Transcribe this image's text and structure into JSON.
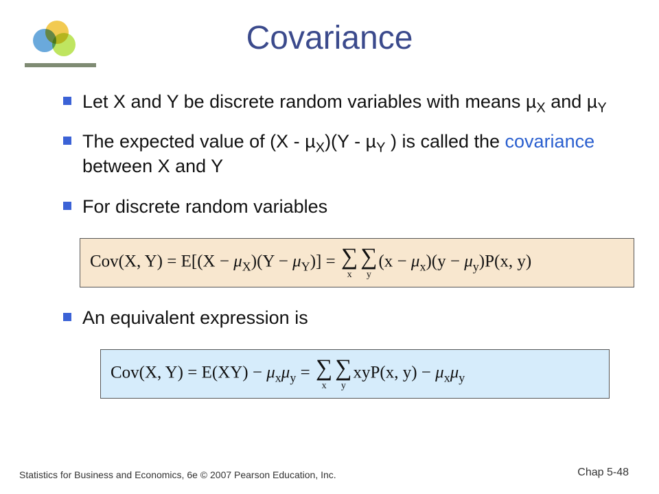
{
  "title": "Covariance",
  "bullets": {
    "b1_prefix": "Let  X  and  Y  be discrete random variables with means µ",
    "b1_x": "X",
    "b1_mid": "  and  µ",
    "b1_y": "Y",
    "b2_prefix": "The expected value of  (X - µ",
    "b2_x": "X",
    "b2_mid1": ")(Y - µ",
    "b2_y": "Y",
    "b2_mid2": " )  is called the ",
    "b2_covar": "covariance",
    "b2_suffix": " between  X  and  Y",
    "b3": "For discrete random variables",
    "b4": "An equivalent expression is"
  },
  "formula1": {
    "lhs": "Cov(X, Y) = E[(X − ",
    "mu": "μ",
    "x": "X",
    "mid1": ")(Y − ",
    "y": "Y",
    "mid2": ")] = ",
    "sum_x": "x",
    "sum_y": "y",
    "rhs1": "(x − ",
    "xs": "x",
    "rhs2": ")(y − ",
    "ys": "y",
    "rhs3": ")P(x, y)",
    "sigma": "∑"
  },
  "formula2": {
    "lhs": "Cov(X, Y) = E(XY) − ",
    "mu": "μ",
    "x": "x",
    "y": "y",
    "eq": " = ",
    "sigma": "∑",
    "sum_x": "x",
    "sum_y": "y",
    "mid": "xyP(x, y) − "
  },
  "footer": {
    "left": "Statistics for Business and Economics, 6e © 2007 Pearson Education, Inc.",
    "right": "Chap 5-48"
  }
}
